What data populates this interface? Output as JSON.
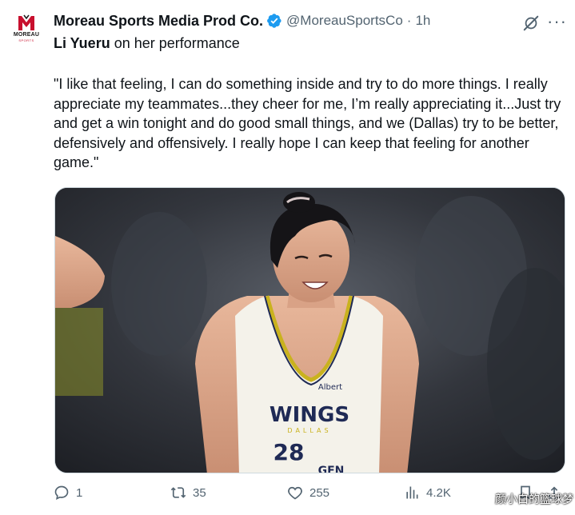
{
  "account": {
    "avatar_brand": "MOREAU",
    "avatar_sub": "SPORTS",
    "display_name": "Moreau Sports Media Prod Co.",
    "handle": "@MoreauSportsCo",
    "separator": "·",
    "time": "1h"
  },
  "tweet": {
    "subject_name": "Li Yueru",
    "subject_rest": " on her performance",
    "quote": "\"I like that feeling, I can do something inside and try to do more things. I really appreciate my teammates...they cheer for me, I’m really appreciating it...Just try and get a win tonight and do good small things, and we (Dallas) try to be better, defensively and offensively. I really hope I can keep that feeling for another game.\"",
    "photo": {
      "jersey_brand": "WINGS",
      "jersey_sponsor": "Albert",
      "jersey_number": "28",
      "jersey_city": "DALLAS",
      "jersey_bottom": "GEN"
    }
  },
  "actions": {
    "replies": "1",
    "reposts": "35",
    "likes": "255",
    "views": "4.2K"
  },
  "watermark": "颜小白的篮球梦",
  "colors": {
    "verified": "#1d9bf0",
    "muted": "#536471",
    "text": "#0f1419",
    "brand_red": "#c8102e"
  }
}
